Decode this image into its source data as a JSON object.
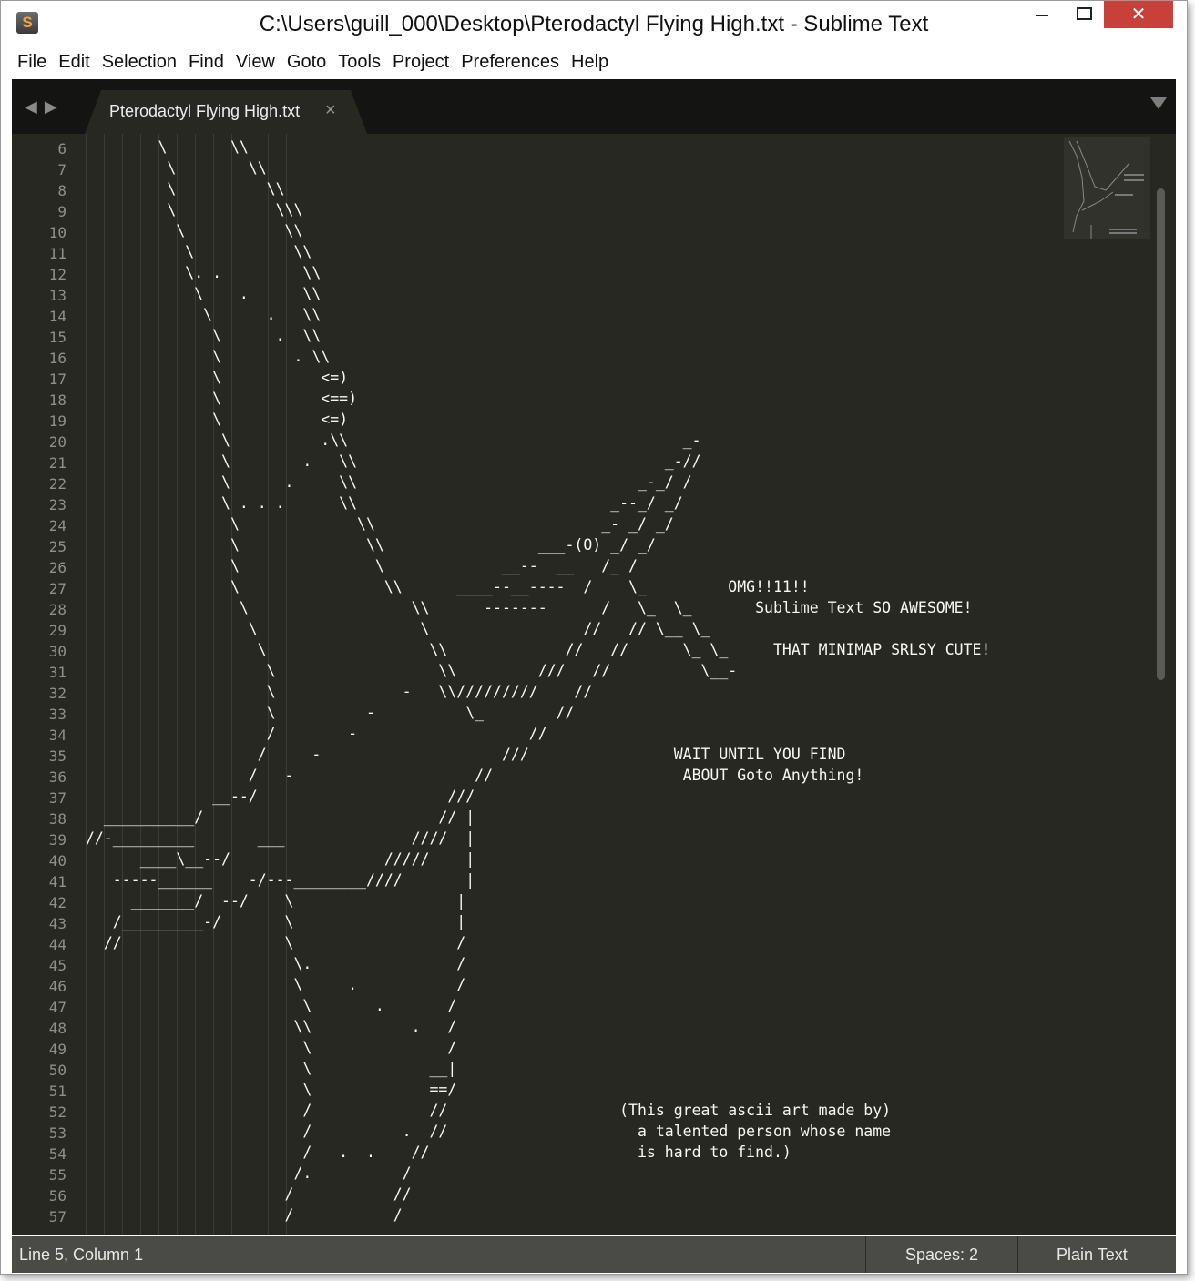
{
  "window": {
    "title": "C:\\Users\\guill_000\\Desktop\\Pterodactyl Flying High.txt - Sublime Text",
    "app_icon": "S"
  },
  "menu": [
    "File",
    "Edit",
    "Selection",
    "Find",
    "View",
    "Goto",
    "Tools",
    "Project",
    "Preferences",
    "Help"
  ],
  "tab": {
    "label": "Pterodactyl Flying High.txt",
    "close_glyph": "×"
  },
  "line_numbers": [
    "6",
    "7",
    "8",
    "9",
    "10",
    "11",
    "12",
    "13",
    "14",
    "15",
    "16",
    "17",
    "18",
    "19",
    "20",
    "21",
    "22",
    "23",
    "24",
    "25",
    "26",
    "27",
    "28",
    "29",
    "30",
    "31",
    "32",
    "33",
    "34",
    "35",
    "36",
    "37",
    "38",
    "39",
    "40",
    "41",
    "42",
    "43",
    "44",
    "45",
    "46",
    "47",
    "48",
    "49",
    "50",
    "51",
    "52",
    "53",
    "54",
    "55",
    "56",
    "57"
  ],
  "lines": [
    "        \\       \\\\",
    "         \\        \\\\",
    "         \\          \\\\",
    "         \\           \\\\\\",
    "          \\           \\\\",
    "           \\           \\\\",
    "           \\. .         \\\\",
    "            \\    .      \\\\",
    "             \\      .   \\\\",
    "              \\      .  \\\\",
    "              \\        . \\\\",
    "              \\           <=)",
    "              \\           <==)",
    "              \\           <=)",
    "               \\          .\\\\                                     _-",
    "               \\        .   \\\\                                  _-//",
    "               \\      .     \\\\                               _-_/ /",
    "               \\ . . .      \\\\                            _--_/ _/",
    "                \\             \\\\                         _- _/ _/",
    "                \\              \\\\                 ___-(O) _/ _/",
    "                \\               \\             __--  __   /_ /",
    "                \\                \\\\      ____--__----  /    \\_         OMG!!11!!",
    "                 \\                  \\\\      -------      /   \\_  \\_       Sublime Text SO AWESOME!",
    "                  \\                  \\                 //   // \\__ \\_",
    "                   \\                  \\\\             //   //      \\_ \\_     THAT MINIMAP SRLSY CUTE!",
    "                    \\                  \\\\         ///   //          \\__-",
    "                    \\              -   \\\\/////////    //",
    "                    \\          -          \\_        //",
    "                    /        -                   //",
    "                   /     -                    ///                WAIT UNTIL YOU FIND",
    "                  /   -                    //                     ABOUT Goto Anything!",
    "              __--/                     ///",
    "  __________/                          // |",
    "//-_________       ___              ////  |",
    "      ____\\__--/                 /////    |",
    "   -----______    -/---________////       |",
    "     _______/  --/    \\                  |",
    "   /_________-/       \\                  |",
    "  //                  \\                  /",
    "                       \\.                /",
    "                       \\     .           /",
    "                        \\       .       /",
    "                       \\\\           .   /",
    "                        \\               /",
    "                        \\             __|",
    "                        \\             ==/",
    "                        /             //                   (This great ascii art made by)",
    "                        /          .  //                     a talented person whose name",
    "                        /   .  .    //                       is hard to find.)",
    "                       /.          /",
    "                      /           //",
    "                      /           /"
  ],
  "status": {
    "position": "Line 5, Column 1",
    "spaces": "Spaces: 2",
    "syntax": "Plain Text"
  },
  "colors": {
    "editor_bg": "#272822",
    "text": "#f8f8f2",
    "line_number": "#8f908a",
    "status_bg": "#4a4b46",
    "close_button": "#c7403a"
  }
}
